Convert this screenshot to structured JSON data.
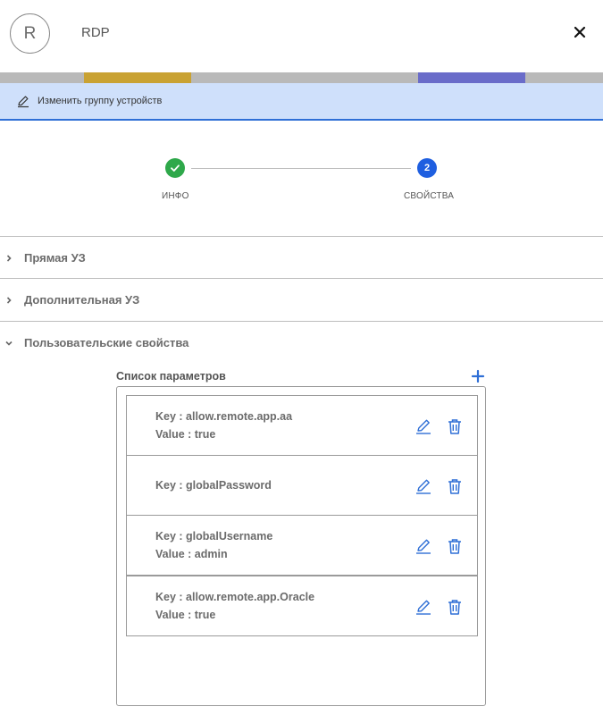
{
  "header": {
    "avatar_letter": "R",
    "title": "RDP"
  },
  "edit_bar": {
    "label": "Изменить группу устройств"
  },
  "stepper": {
    "steps": [
      {
        "label": "ИНФО",
        "status": "done"
      },
      {
        "label": "СВОЙСТВА",
        "status": "active",
        "number": "2"
      }
    ]
  },
  "sections": [
    {
      "label": "Прямая УЗ",
      "expanded": false
    },
    {
      "label": "Дополнительная УЗ",
      "expanded": false
    },
    {
      "label": "Пользовательские свойства",
      "expanded": true
    }
  ],
  "params": {
    "title": "Список параметров",
    "items": [
      {
        "key": "Key : allow.remote.app.aa",
        "value": "Value : true"
      },
      {
        "key": "Key : globalPassword",
        "value": ""
      },
      {
        "key": "Key : globalUsername",
        "value": "Value : admin"
      },
      {
        "key": "Key : allow.remote.app.Oracle",
        "value": "Value : true"
      }
    ]
  },
  "colors": {
    "accent": "#1f5fe0",
    "success": "#2ea84a",
    "edit_bar_bg": "#cfe0fb",
    "icon_blue": "#2f6fd6"
  }
}
